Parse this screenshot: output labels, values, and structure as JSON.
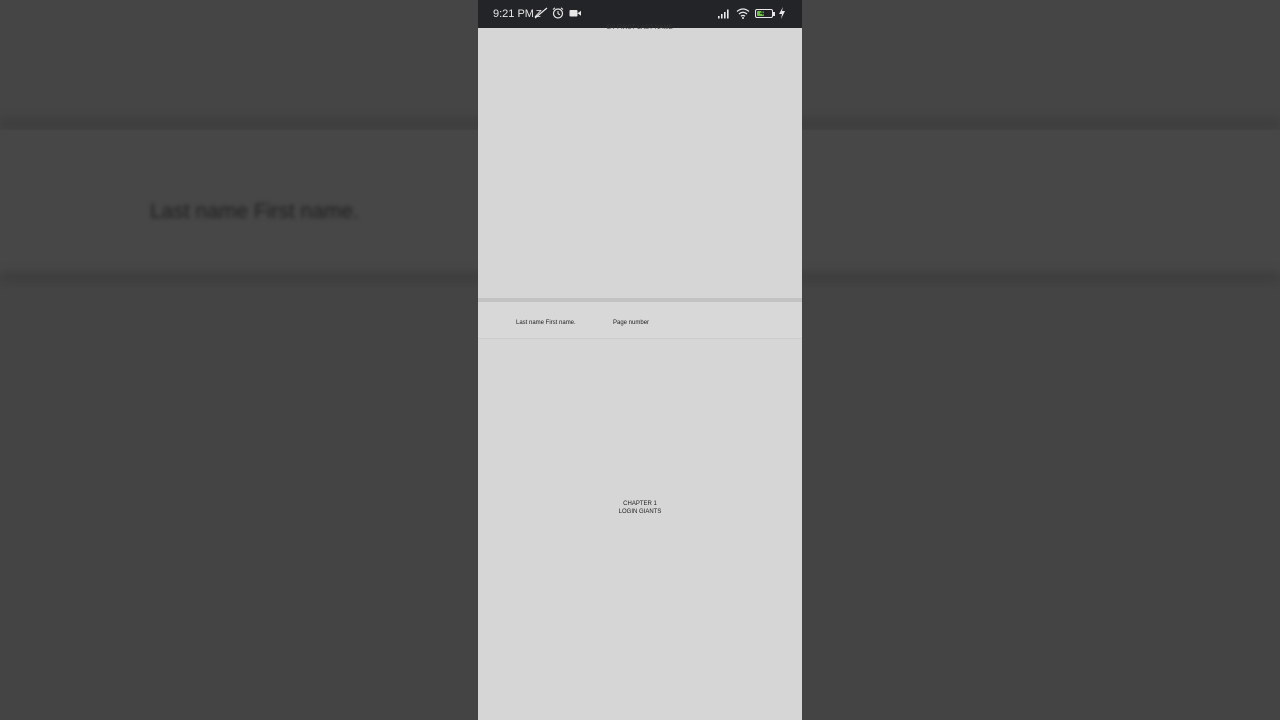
{
  "backdrop": {
    "blurred_text": "Last name First name."
  },
  "status_bar": {
    "time": "9:21 PM",
    "battery_level": "41",
    "icons_left": [
      "dnd-off-icon",
      "alarm-icon",
      "video-record-icon"
    ],
    "icons_right": [
      "signal-icon",
      "wifi-icon",
      "battery-icon",
      "charging-icon"
    ],
    "battery_color": "#6fc04a"
  },
  "document": {
    "byline": "BY FIRST LAST NAME",
    "header": {
      "name": "Last name First name.",
      "page_label": "Page number"
    },
    "chapter": {
      "number": "CHAPTER 1",
      "title": "LOGIN GIANTS"
    }
  },
  "colors": {
    "outer_background": "#444444",
    "page_background": "#d6d6d6",
    "status_bar_background": "#222427"
  }
}
